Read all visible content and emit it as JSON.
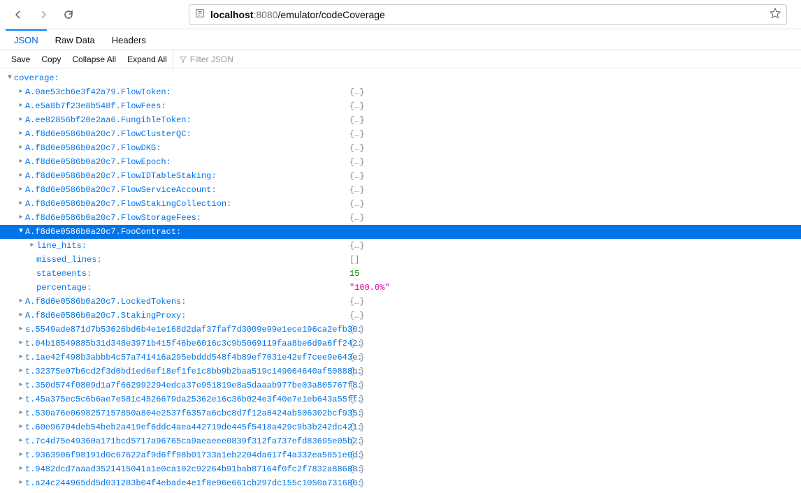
{
  "url": {
    "host": "localhost",
    "port": ":8080",
    "path": "/emulator/codeCoverage"
  },
  "tabs": {
    "json": "JSON",
    "rawdata": "Raw Data",
    "headers": "Headers"
  },
  "subtoolbar": {
    "save": "Save",
    "copy": "Copy",
    "collapse": "Collapse All",
    "expand": "Expand All",
    "filter_placeholder": "Filter JSON"
  },
  "root_key": "coverage:",
  "summary": "{…}",
  "array_empty": "[]",
  "items": [
    {
      "key": "A.0ae53cb6e3f42a79.FlowToken:"
    },
    {
      "key": "A.e5a8b7f23e8b548f.FlowFees:"
    },
    {
      "key": "A.ee82856bf20e2aa6.FungibleToken:"
    },
    {
      "key": "A.f8d6e0586b0a20c7.FlowClusterQC:"
    },
    {
      "key": "A.f8d6e0586b0a20c7.FlowDKG:"
    },
    {
      "key": "A.f8d6e0586b0a20c7.FlowEpoch:"
    },
    {
      "key": "A.f8d6e0586b0a20c7.FlowIDTableStaking:"
    },
    {
      "key": "A.f8d6e0586b0a20c7.FlowServiceAccount:"
    },
    {
      "key": "A.f8d6e0586b0a20c7.FlowStakingCollection:"
    },
    {
      "key": "A.f8d6e0586b0a20c7.FlowStorageFees:"
    }
  ],
  "selected": {
    "key": "A.f8d6e0586b0a20c7.FooContract:"
  },
  "children": {
    "line_hits": "line_hits:",
    "missed_lines": "missed_lines:",
    "statements": "statements:",
    "statements_val": "15",
    "percentage": "percentage:",
    "percentage_val": "\"100.0%\""
  },
  "items_after": [
    {
      "key": "A.f8d6e0586b0a20c7.LockedTokens:"
    },
    {
      "key": "A.f8d6e0586b0a20c7.StakingProxy:"
    },
    {
      "key": "s.5549ade871d7b53626bd6b4e1e168d2daf37faf7d3009e99e1ece196ca2efb30:"
    },
    {
      "key": "t.04b18549885b31d348e3971b415f46be6016c3c9b5069119faa8be6d9a6ff242:"
    },
    {
      "key": "t.1ae42f498b3abbb4c57a741416a295ebddd548f4b89ef7031e42ef7cee9e643e:"
    },
    {
      "key": "t.32375e07b6cd2f3d0bd1ed6ef18ef1fe1c8bb9b2baa519c149064640af50888b:"
    },
    {
      "key": "t.350d574f0809d1a7f662992294edca37e951819e8a5daaab977be03a805767f8:"
    },
    {
      "key": "t.45a375ec5c6b6ae7e581c4526679da25362e16c36b024e3f40e7e1eb643a55ff:"
    },
    {
      "key": "t.530a76e0698257157850a804e2537f6357a6cbc8d7f12a8424ab506302bcf935:"
    },
    {
      "key": "t.60e96704deb54beb2a419ef6ddc4aea442719de445f5418a429c9b3b242dc421:"
    },
    {
      "key": "t.7c4d75e49360a171bcd5717a96765ca9aeaeee0839f312fa737efd83695e05b2:"
    },
    {
      "key": "t.9363906f98191d0c67622af9d6ff98b01733a1eb2204da617f4a332ea5851e0d:"
    },
    {
      "key": "t.9482dcd7aaad3521415041a1e0ca102c92264b91bab87164f0fc2f7832a88688:"
    },
    {
      "key": "t.a24c244965dd5d031283b04f4ebade4e1f8e96e661cb297dc155c1050a731680:"
    }
  ]
}
